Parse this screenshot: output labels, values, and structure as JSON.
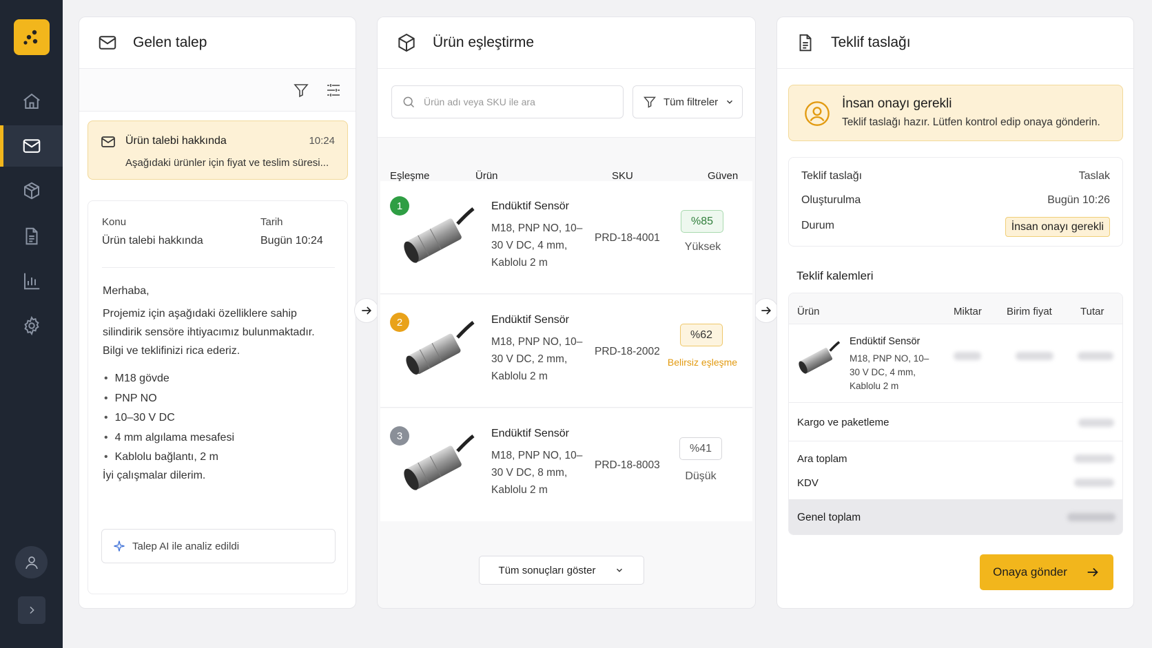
{
  "inbox": {
    "title": "Gelen talep",
    "message": {
      "subject": "Ürün talebi hakkında",
      "time": "10:24",
      "preview": "Aşağıdaki ürünler için fiyat ve teslim süresi..."
    },
    "detail": {
      "subject_label": "Konu",
      "subject_value": "Ürün talebi hakkında",
      "date_label": "Tarih",
      "date_value": "Bugün 10:24",
      "greeting": "Merhaba,",
      "body": "Projemiz için aşağıdaki özelliklere sahip silindirik sensöre ihtiyacımız bulunmaktadır. Bilgi ve teklifinizi rica ederiz.",
      "bullets": [
        "M18 gövde",
        "PNP NO",
        "10–30 V DC",
        "4 mm algılama mesafesi",
        "Kablolu bağlantı, 2 m"
      ],
      "closing": "İyi çalışmalar dilerim.",
      "ai_note": "Talep AI ile analiz edildi"
    }
  },
  "matching": {
    "title": "Ürün eşleştirme",
    "search_placeholder": "Ürün adı veya SKU ile ara",
    "filter_label": "Tüm filtreler",
    "columns": {
      "match": "Eşleşme",
      "product": "Ürün",
      "sku": "SKU",
      "confidence": "Güven"
    },
    "results": [
      {
        "rank": "1",
        "name": "Endüktif Sensör",
        "desc": "M18, PNP NO, 10–30 V DC, 4 mm, Kablolu 2 m",
        "sku": "PRD-18-4001",
        "confidence": "%85",
        "level": "Yüksek"
      },
      {
        "rank": "2",
        "name": "Endüktif Sensör",
        "desc": "M18, PNP NO, 10–30 V DC, 2 mm, Kablolu 2 m",
        "sku": "PRD-18-2002",
        "confidence": "%62",
        "level": "Belirsiz eşleşme"
      },
      {
        "rank": "3",
        "name": "Endüktif Sensör",
        "desc": "M18, PNP NO, 10–30 V DC, 8 mm, Kablolu 2 m",
        "sku": "PRD-18-8003",
        "confidence": "%41",
        "level": "Düşük"
      }
    ],
    "show_all": "Tüm sonuçları göster"
  },
  "quote": {
    "title": "Teklif taslağı",
    "approval_title": "İnsan onayı gerekli",
    "approval_text": "Teklif taslağı hazır. Lütfen kontrol edip onaya gönderin.",
    "meta": {
      "draft_label": "Teklif taslağı",
      "draft_value": "Taslak",
      "created_label": "Oluşturulma",
      "created_value": "Bugün 10:26",
      "status_label": "Durum",
      "status_value": "İnsan onayı gerekli"
    },
    "items_title": "Teklif kalemleri",
    "columns": {
      "product": "Ürün",
      "qty": "Miktar",
      "unit_price": "Birim fiyat",
      "amount": "Tutar"
    },
    "item": {
      "name": "Endüktif Sensör",
      "desc": "M18, PNP NO, 10–30 V DC, 4 mm, Kablolu 2 m"
    },
    "shipping_label": "Kargo ve paketleme",
    "subtotal_label": "Ara toplam",
    "tax_label": "KDV",
    "total_label": "Genel toplam",
    "submit_label": "Onaya gönder"
  },
  "colors": {
    "accent": "#f2b61c",
    "rail": "#1f2632",
    "high": "#2f9e44",
    "medium": "#e9a21a",
    "low": "#8a8f98"
  }
}
